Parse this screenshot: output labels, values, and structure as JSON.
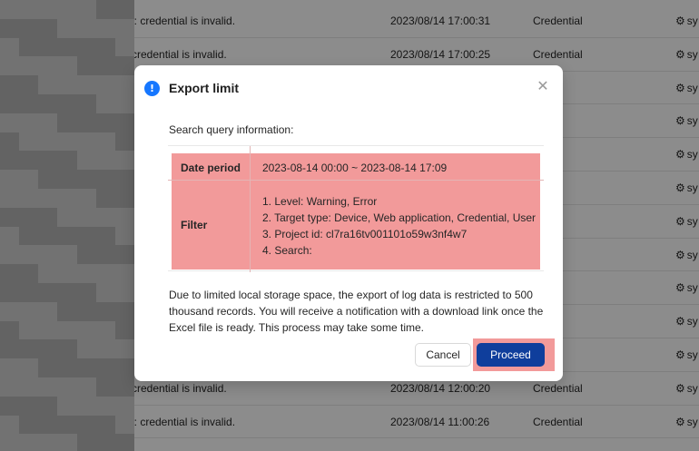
{
  "background_table": {
    "rows": [
      {
        "message": "l: credential is invalid.",
        "time": "2023/08/14 17:00:31",
        "type": "Credential",
        "user": "sy"
      },
      {
        "message": "credential is invalid.",
        "time": "2023/08/14 17:00:25",
        "type": "Credential",
        "user": "sy"
      },
      {
        "message": "",
        "time": "",
        "type": "",
        "user": "sy"
      },
      {
        "message": "",
        "time": "",
        "type": "",
        "user": "sy"
      },
      {
        "message": "",
        "time": "",
        "type": "",
        "user": "sy"
      },
      {
        "message": "",
        "time": "",
        "type": "",
        "user": "sy"
      },
      {
        "message": "",
        "time": "",
        "type": "",
        "user": "sy"
      },
      {
        "message": "",
        "time": "",
        "type": "",
        "user": "sy"
      },
      {
        "message": "",
        "time": "",
        "type": "",
        "user": "sy"
      },
      {
        "message": "",
        "time": "",
        "type": "",
        "user": "sy"
      },
      {
        "message": "",
        "time": "",
        "type": "",
        "user": "sy"
      },
      {
        "message": "credential is invalid.",
        "time": "2023/08/14 12:00:20",
        "type": "Credential",
        "user": "sy"
      },
      {
        "message": "l: credential is invalid.",
        "time": "2023/08/14 11:00:26",
        "type": "Credential",
        "user": "sy"
      }
    ]
  },
  "modal": {
    "title": "Export limit",
    "info_icon_glyph": "!",
    "close_glyph": "✕",
    "section_label": "Search query information:",
    "date_period_label": "Date period",
    "date_period_value": "2023-08-14 00:00 ~ 2023-08-14 17:09",
    "filter_label": "Filter",
    "filters": [
      "1. Level: Warning, Error",
      "2. Target type: Device, Web application, Credential, User",
      "3. Project id: cl7ra16tv001101o59w3nf4w7",
      "4. Search:"
    ],
    "notice": "Due to limited local storage space, the export of log data is restricted to 500 thousand records. You will receive a notification with a download link once the Excel file is ready. This process may take some time.",
    "cancel_label": "Cancel",
    "proceed_label": "Proceed"
  },
  "colors": {
    "primary": "#0f3e9c",
    "info": "#1677ff",
    "highlight": "#f29a9a"
  },
  "icons": {
    "user_cell": "gear-icon",
    "modal_header": "info-icon",
    "close": "close-icon"
  }
}
